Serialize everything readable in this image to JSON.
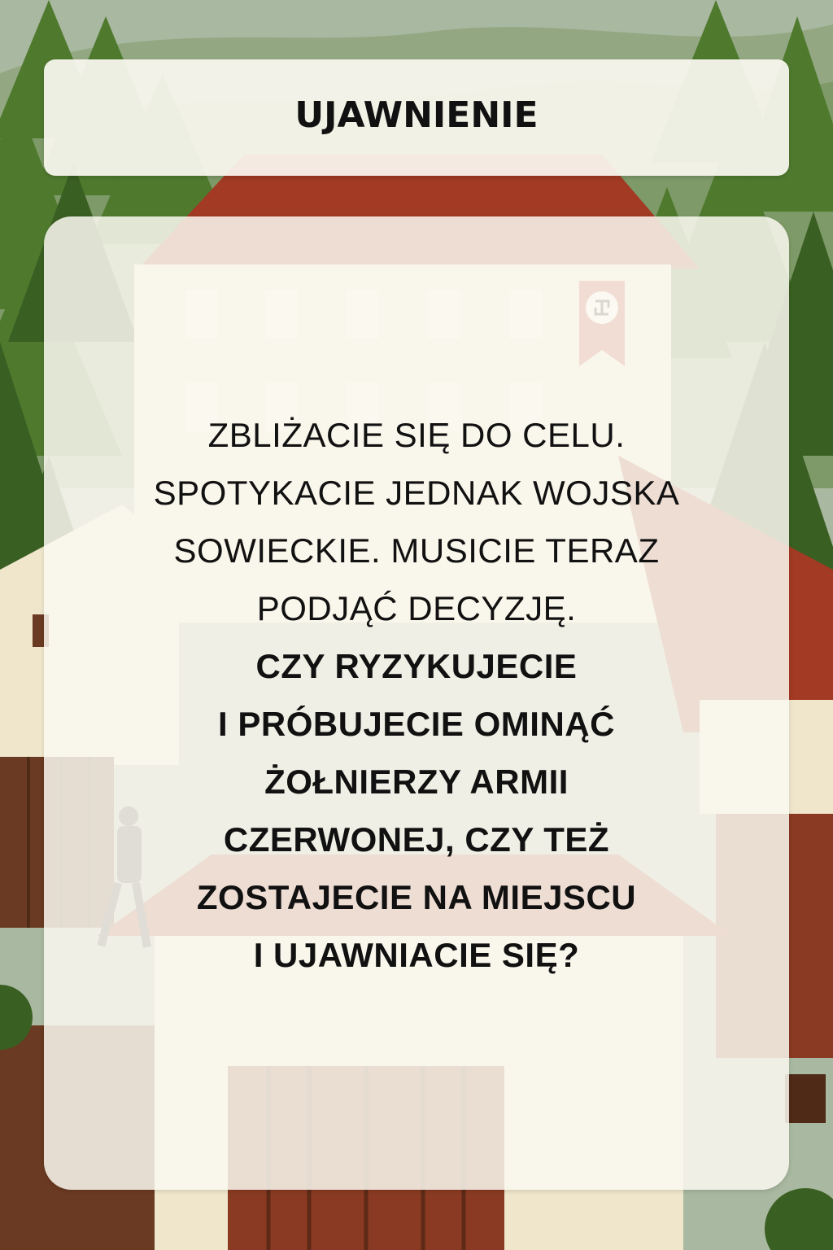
{
  "card": {
    "title": "UJAWNIENIE",
    "narrative_lines": [
      "ZBLIŻACIE SIĘ DO CELU.",
      "SPOTYKACIE JEDNAK WOJSKA",
      "SOWIECKIE. MUSICIE TERAZ",
      "PODJĄĆ DECYZJĘ."
    ],
    "question_lines": [
      "CZY RYZYKUJECIE",
      "I PRÓBUJECIE OMINĄĆ",
      "ŻOŁNIERZY ARMII",
      "CZERWONEJ, CZY TEŻ",
      "ZOSTAJECIE NA MIEJSCU",
      "I UJAWNIACIE SIĘ?"
    ]
  },
  "colors": {
    "forest": "#4f7a2e",
    "forest_dark": "#3a5f22",
    "roof": "#a23a24",
    "wall": "#efe6cc",
    "wood": "#6b3a22",
    "banner": "#b5382a",
    "sky": "#a9b8a0"
  },
  "icons": [
    "pine-tree-icon",
    "banner-flag-icon",
    "walking-figure-icon"
  ]
}
